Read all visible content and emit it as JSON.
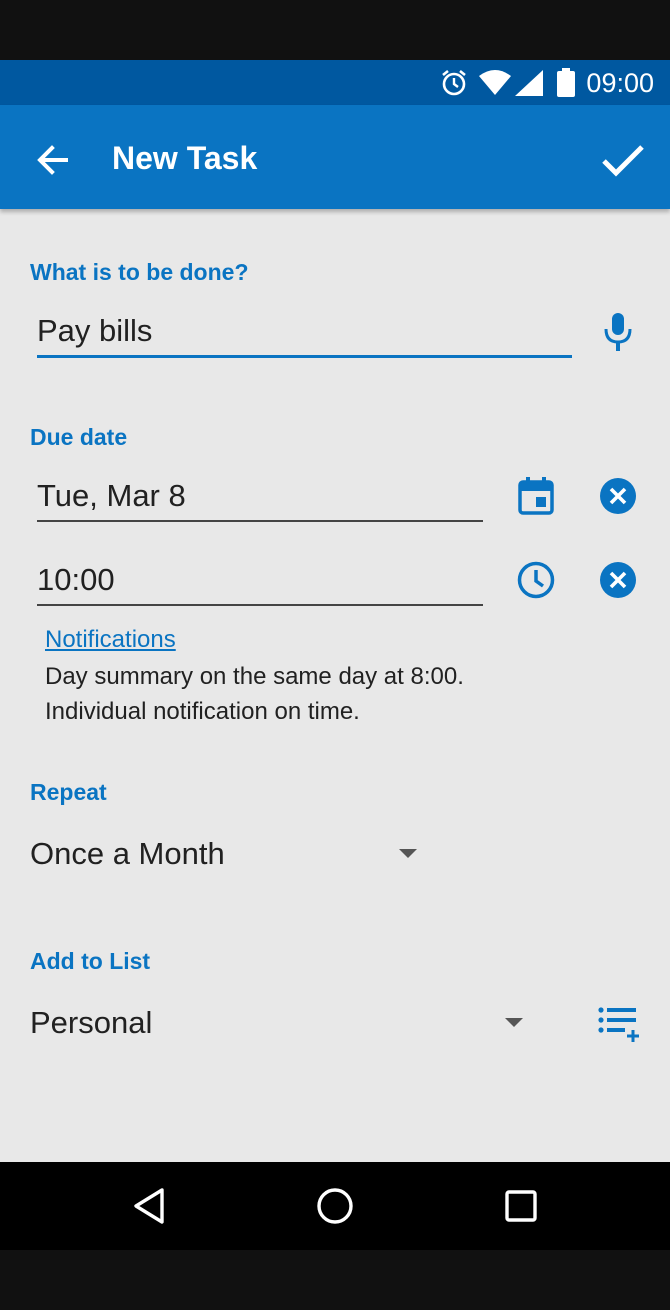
{
  "status_bar": {
    "time": "09:00",
    "icons": [
      "alarm-icon",
      "wifi-icon",
      "signal-icon",
      "battery-icon"
    ]
  },
  "app_bar": {
    "title": "New Task",
    "back_icon": "arrow-back-icon",
    "confirm_icon": "check-icon"
  },
  "task": {
    "label": "What is to be done?",
    "value": "Pay bills",
    "voice_icon": "microphone-icon"
  },
  "due_date": {
    "label": "Due date",
    "date_value": "Tue, Mar 8",
    "time_value": "10:00",
    "calendar_icon": "calendar-icon",
    "clock_icon": "clock-icon",
    "clear_icon": "clear-circle-icon"
  },
  "notifications": {
    "link": "Notifications",
    "line1": "Day summary on the same day at 8:00.",
    "line2": "Individual notification on time."
  },
  "repeat": {
    "label": "Repeat",
    "selected": "Once a Month"
  },
  "list": {
    "label": "Add to List",
    "selected": "Personal",
    "add_list_icon": "playlist-add-icon"
  },
  "nav_bar": {
    "icons": [
      "back-triangle-icon",
      "home-circle-icon",
      "recents-square-icon"
    ]
  },
  "colors": {
    "accent": "#0a74c2",
    "status_bar": "#0058a0",
    "background": "#e8e8e8"
  }
}
